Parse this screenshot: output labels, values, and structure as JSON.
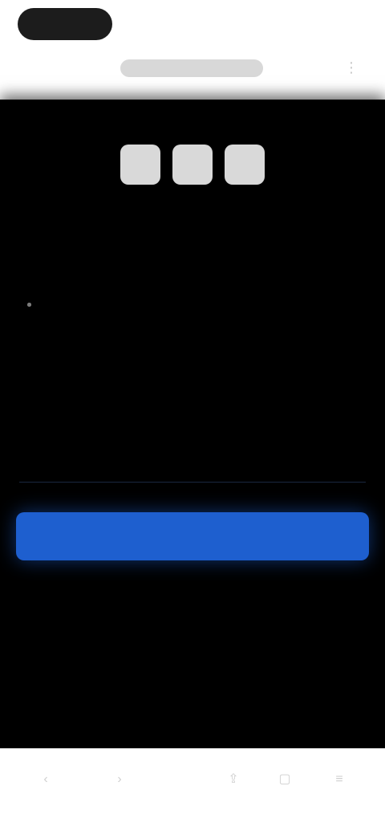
{
  "top_bar": {
    "tab_label": "",
    "right_icon": "more-icon"
  },
  "panel": {
    "corner_label": "",
    "code_digits": [
      "",
      "",
      ""
    ],
    "heading": "",
    "info_title": "",
    "info_items": [
      "",
      "",
      ""
    ],
    "field_label": "",
    "field_link": "",
    "button_label": ""
  },
  "bottom_nav": {
    "icons": [
      "back-icon",
      "forward-icon",
      "share-icon",
      "tabs-icon",
      "menu-icon"
    ]
  },
  "colors": {
    "panel_background": "#000000",
    "button_accent": "#1e5fcf",
    "code_box": "#d9d9d9"
  }
}
